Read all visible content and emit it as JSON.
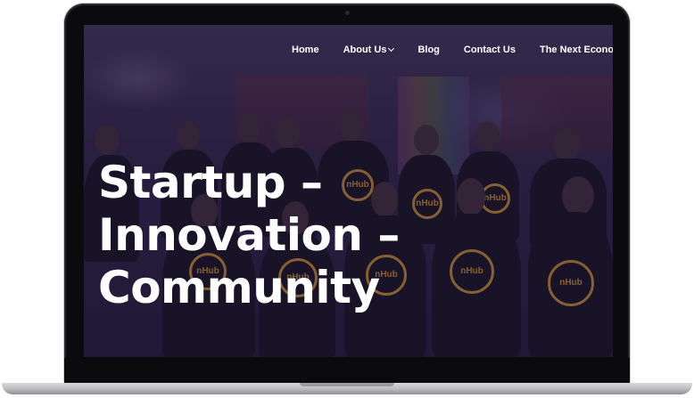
{
  "nav": {
    "items": [
      {
        "label": "Home",
        "has_dropdown": false
      },
      {
        "label": "About Us",
        "has_dropdown": true
      },
      {
        "label": "Blog",
        "has_dropdown": false
      },
      {
        "label": "Contact Us",
        "has_dropdown": false
      },
      {
        "label": "The Next Economy Jos",
        "has_dropdown": false
      }
    ]
  },
  "hero": {
    "lines": [
      "Startup –",
      "Innovation –",
      "Community"
    ]
  },
  "shirt_logo": "nHub",
  "colors": {
    "overlay": "#281946",
    "logo_gold": "#b8842a",
    "text": "#ffffff"
  },
  "icons": {
    "dropdown": "chevron-down-icon"
  }
}
